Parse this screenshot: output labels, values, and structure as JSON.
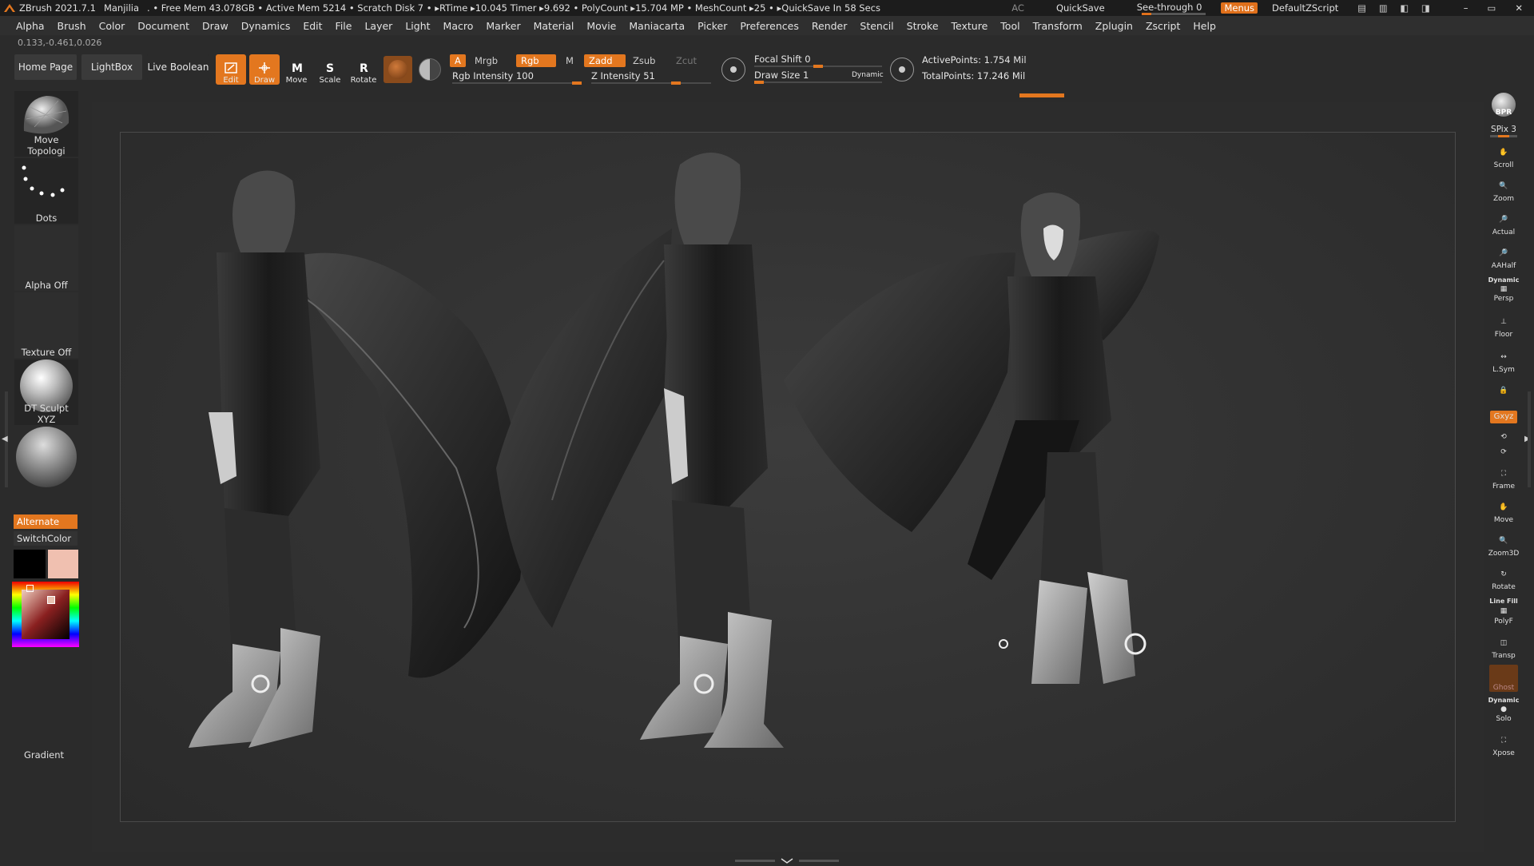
{
  "titlebar": {
    "app": "ZBrush 2021.7.1",
    "document": "Manjilia",
    "stats": ". • Free Mem 43.078GB • Active Mem 5214 • Scratch Disk 7 • ▸RTime ▸10.045 Timer ▸9.692 • PolyCount ▸15.704 MP • MeshCount ▸25 • ▸QuickSave In 58 Secs",
    "ac": "AC",
    "quicksave": "QuickSave",
    "seethrough": "See-through   0",
    "menus": "Menus",
    "defaultzscript": "DefaultZScript"
  },
  "menubar": [
    "Alpha",
    "Brush",
    "Color",
    "Document",
    "Draw",
    "Dynamics",
    "Edit",
    "File",
    "Layer",
    "Light",
    "Macro",
    "Marker",
    "Material",
    "Movie",
    "Maniacarta",
    "Picker",
    "Preferences",
    "Render",
    "Stencil",
    "Stroke",
    "Texture",
    "Tool",
    "Transform",
    "Zplugin",
    "Zscript",
    "Help"
  ],
  "coords": "0.133,-0.461,0.026",
  "shelf": {
    "home_page": "Home Page",
    "lightbox": "LightBox",
    "live_boolean": "Live Boolean",
    "edit": "Edit",
    "draw": "Draw",
    "move": "Move",
    "scale": "Scale",
    "rotate": "Rotate",
    "a_chip": "A",
    "mrgb": "Mrgb",
    "rgb": "Rgb",
    "m": "M",
    "zadd": "Zadd",
    "zsub": "Zsub",
    "zcut": "Zcut",
    "rgb_intensity": "Rgb Intensity 100",
    "z_intensity": "Z Intensity 51",
    "focal_shift": "Focal Shift 0",
    "draw_size": "Draw Size 1",
    "dynamic": "Dynamic",
    "active_points": "ActivePoints: 1.754 Mil",
    "total_points": "TotalPoints: 17.246 Mil"
  },
  "left_tray": {
    "brush": "Move Topologi",
    "stroke": "Dots",
    "alpha": "Alpha Off",
    "texture": "Texture Off",
    "material": "DT Sculpt XYZ",
    "alternate": "Alternate",
    "switch_color": "SwitchColor",
    "gradient": "Gradient",
    "main_color": "#000000",
    "secondary_color": "#f0c0b0"
  },
  "right_tray": {
    "bpr": "BPR",
    "spix": "SPix 3",
    "scroll": "Scroll",
    "zoom": "Zoom",
    "actual": "Actual",
    "aahalf": "AAHalf",
    "dynamic": "Dynamic",
    "persp": "Persp",
    "floor": "Floor",
    "lsym": "L.Sym",
    "xyz": "Gxyz",
    "frame": "Frame",
    "move": "Move",
    "zoom3d": "Zoom3D",
    "rotate": "Rotate",
    "linefill": "Line Fill",
    "polyf": "PolyF",
    "transp": "Transp",
    "ghost": "Ghost",
    "dynamic2": "Dynamic",
    "solo": "Solo",
    "xpose": "Xpose"
  },
  "colors": {
    "accent": "#e3771f",
    "bg": "#2b2b2b"
  }
}
